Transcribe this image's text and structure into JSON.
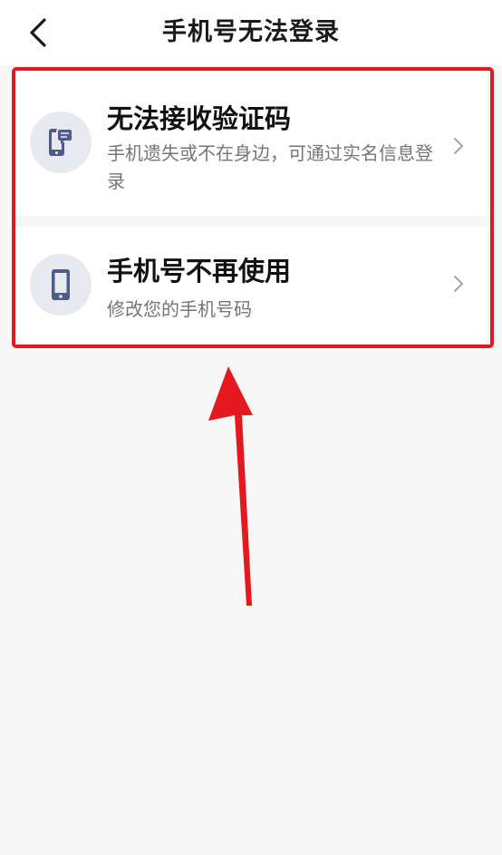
{
  "header": {
    "title": "手机号无法登录",
    "back_icon": "chevron-left-icon"
  },
  "options": [
    {
      "title": "无法接收验证码",
      "description": "手机遗失或不在身边，可通过实名信息登录",
      "icon": "phone-message-icon"
    },
    {
      "title": "手机号不再使用",
      "description": "修改您的手机号码",
      "icon": "mobile-phone-icon"
    }
  ],
  "colors": {
    "background": "#f6f6f6",
    "card": "#ffffff",
    "icon_bg": "#e7e9ef",
    "icon_fg": "#4c5d8a",
    "annotation_red": "#e4181f"
  }
}
